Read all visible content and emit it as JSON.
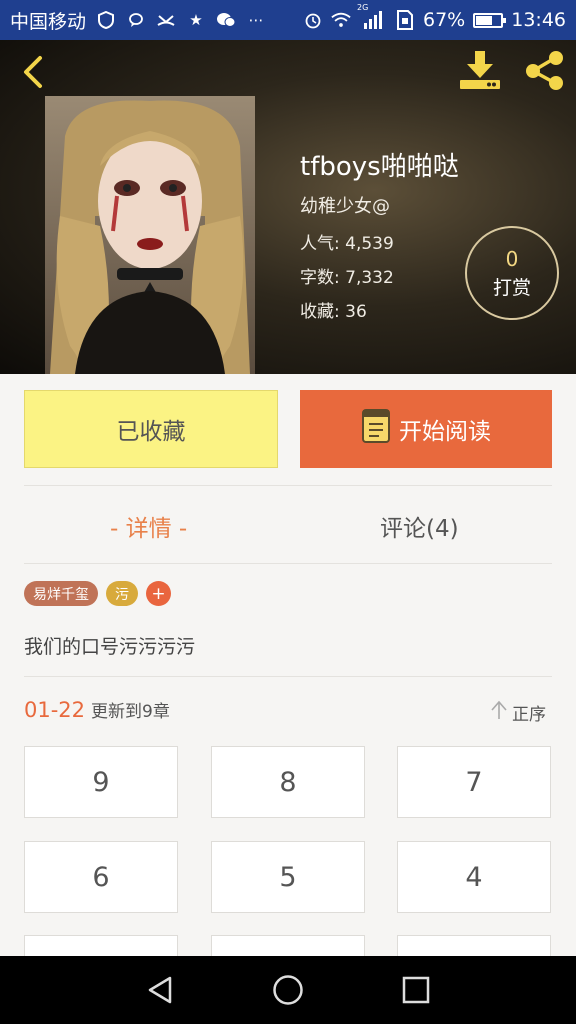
{
  "status_bar": {
    "carrier": "中国移动",
    "battery": "67%",
    "time": "13:46",
    "battery_level": 0.67,
    "network_label": "2G"
  },
  "book": {
    "title": "tfboys啪啪哒",
    "author": "幼稚少女@",
    "stats": [
      {
        "label": "人气:",
        "value": "4,539"
      },
      {
        "label": "字数:",
        "value": "7,332"
      },
      {
        "label": "收藏:",
        "value": "36"
      }
    ],
    "reward_count": "0",
    "reward_label": "打赏"
  },
  "actions": {
    "favorite_label": "已收藏",
    "read_label": "开始阅读"
  },
  "tabs": {
    "detail": "- 详情 -",
    "comments": "评论(4)"
  },
  "tags": [
    "易烊千玺",
    "污",
    "+"
  ],
  "description": "我们的口号污污污污",
  "update": {
    "date": "01-22",
    "text": "更新到9章",
    "order_label": "正序"
  },
  "chapters": [
    "9",
    "8",
    "7",
    "6",
    "5",
    "4",
    "",
    "",
    ""
  ],
  "colors": {
    "accent": "#e8693d",
    "favorite_bg": "#fbf384",
    "statusbar_bg": "#1f3f8f"
  },
  "icons": {
    "header": [
      "back-arrow-icon",
      "download-icon",
      "share-icon"
    ],
    "nav": [
      "nav-back-icon",
      "nav-home-icon",
      "nav-recent-icon"
    ]
  }
}
